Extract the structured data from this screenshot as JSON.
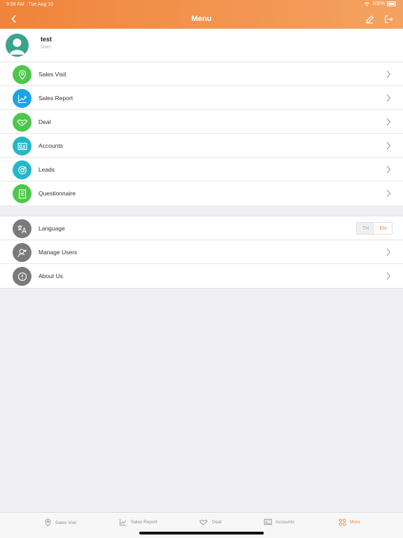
{
  "status": {
    "time": "9:58 AM",
    "date": "Tue Aug 10",
    "battery": "100%"
  },
  "nav": {
    "title": "Menu"
  },
  "profile": {
    "name": "test",
    "role": "User"
  },
  "menu": [
    {
      "label": "Sales Visit",
      "color": "#4cc74a",
      "icon": "location-pin-icon"
    },
    {
      "label": "Sales Report",
      "color": "#1aa3e8",
      "icon": "chart-line-icon"
    },
    {
      "label": "Deal",
      "color": "#4cc74a",
      "icon": "handshake-icon"
    },
    {
      "label": "Accounts",
      "color": "#22b8c9",
      "icon": "id-card-icon"
    },
    {
      "label": "Leads",
      "color": "#22b8c9",
      "icon": "target-icon"
    },
    {
      "label": "Questionnaire",
      "color": "#4cc74a",
      "icon": "document-icon"
    }
  ],
  "settings": {
    "language": {
      "label": "Language",
      "options": [
        "TH",
        "EN"
      ],
      "selected": "EN"
    },
    "manage_users": {
      "label": "Manage Users"
    },
    "about": {
      "label": "About Us"
    },
    "icon_color": "#7a7a7a"
  },
  "tabs": [
    {
      "label": "Sales Visit",
      "icon": "location-pin-icon"
    },
    {
      "label": "Sales Report",
      "icon": "chart-line-icon"
    },
    {
      "label": "Deal",
      "icon": "handshake-icon"
    },
    {
      "label": "Accounts",
      "icon": "id-card-icon"
    },
    {
      "label": "More",
      "icon": "grid-icon",
      "active": true
    }
  ],
  "colors": {
    "accent": "#f0843a",
    "background": "#efeff4"
  }
}
